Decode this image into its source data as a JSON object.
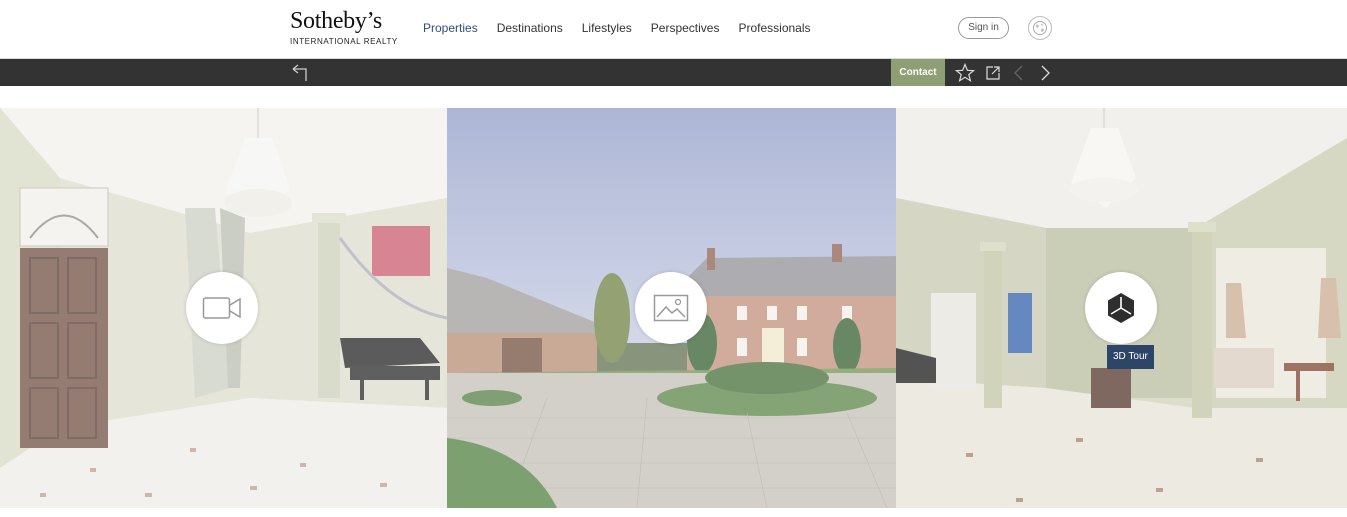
{
  "logo": {
    "main": "Sotheby’s",
    "sub": "INTERNATIONAL REALTY"
  },
  "nav": {
    "items": [
      "Properties",
      "Destinations",
      "Lifestyles",
      "Perspectives",
      "Professionals"
    ],
    "active": "Properties"
  },
  "header": {
    "signin_label": "Sign in"
  },
  "actionbar": {
    "contact_label": "Contact"
  },
  "gallery": {
    "panels": [
      {
        "name": "video",
        "icon": "video-camera-icon"
      },
      {
        "name": "photos",
        "icon": "image-icon"
      },
      {
        "name": "3d-tour",
        "icon": "3d-tour-icon",
        "tooltip": "3D Tour"
      }
    ]
  },
  "colors": {
    "accent_nav": "#2f4f7f",
    "actionbar_bg": "#333333",
    "contact_bg": "#8e9f74",
    "tooltip_bg": "#2d4566"
  }
}
